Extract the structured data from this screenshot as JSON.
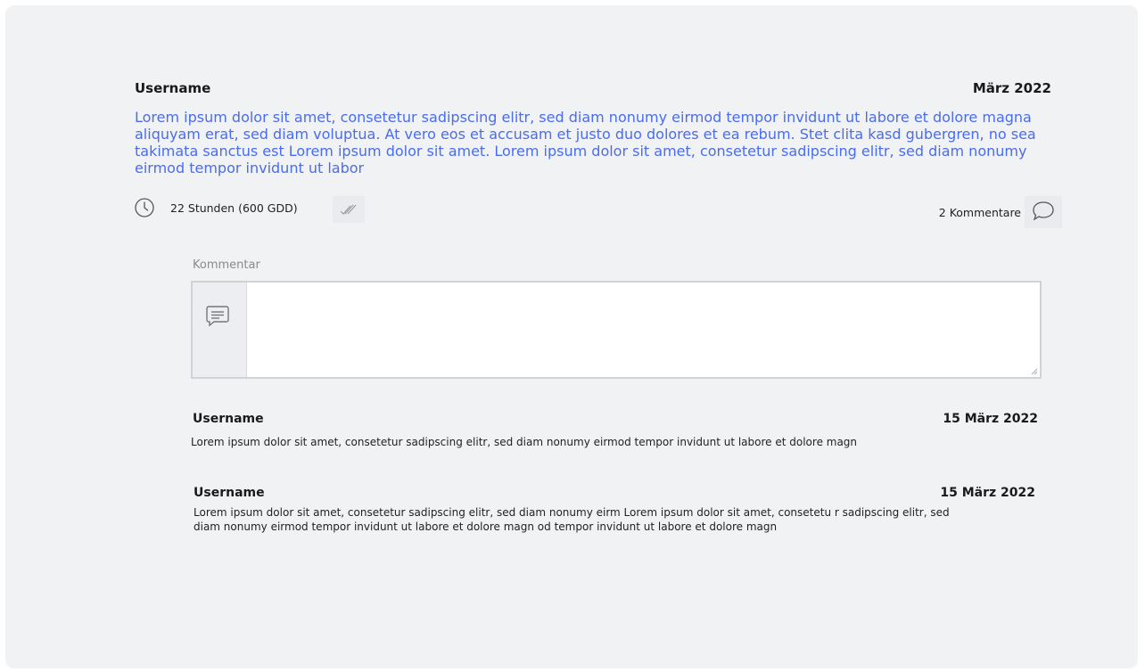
{
  "post": {
    "username": "Username",
    "date": "März 2022",
    "body": "Lorem ipsum dolor sit amet, consetetur sadipscing elitr, sed diam nonumy eirmod tempor invidunt ut labore et dolore magna aliquyam erat, sed diam voluptua. At vero eos et accusam et justo duo dolores et ea rebum. Stet clita kasd gubergren, no sea takimata sanctus est Lorem ipsum dolor sit amet. Lorem ipsum dolor sit amet, consetetur sadipscing elitr, sed diam nonumy eirmod tempor invidunt ut labor",
    "duration": "22 Stunden  (600 GDD)",
    "comments_count": "2 Kommentare",
    "icons": {
      "time": "clock-icon",
      "done": "double-check-icon",
      "comments": "speech-bubble-icon"
    }
  },
  "comment_form": {
    "label": "Kommentar",
    "value": "",
    "icon": "message-icon"
  },
  "replies": [
    {
      "username": "Username",
      "date": "15 März 2022",
      "text": "Lorem ipsum dolor sit amet, consetetur sadipscing elitr, sed diam nonumy eirmod tempor invidunt ut labore et dolore magn"
    },
    {
      "username": "Username",
      "date": "15 März 2022",
      "text": "Lorem ipsum dolor sit amet, consetetur sadipscing elitr, sed diam nonumy eirm Lorem ipsum dolor sit amet, consetetu r sadipscing elitr, sed diam nonumy eirmod tempor invidunt ut labore et dolore magn od tempor invidunt ut labore et dolore magn"
    }
  ],
  "colors": {
    "accent": "#4a6cf0",
    "background": "#f1f2f4",
    "text": "#1a1a1a"
  }
}
